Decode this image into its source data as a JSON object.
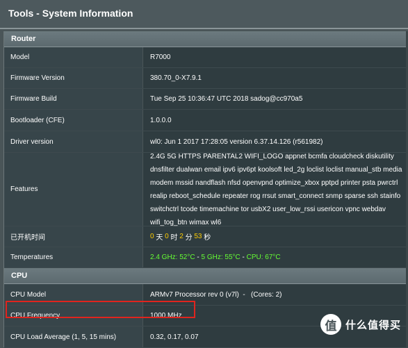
{
  "header": {
    "title": "Tools - System Information"
  },
  "router": {
    "section_label": "Router",
    "model_label": "Model",
    "model_value": "R7000",
    "firmware_version_label": "Firmware Version",
    "firmware_version_value": "380.70_0-X7.9.1",
    "firmware_build_label": "Firmware Build",
    "firmware_build_value": "Tue Sep 25 10:36:47 UTC 2018 sadog@cc970a5",
    "bootloader_label": "Bootloader (CFE)",
    "bootloader_value": "1.0.0.0",
    "driver_label": "Driver version",
    "driver_value": "wl0: Jun 1 2017 17:28:05 version 6.37.14.126 (r561982)",
    "features_label": "Features",
    "features_value": "2.4G 5G HTTPS PARENTAL2 WIFI_LOGO appnet bcmfa cloudcheck diskutility dnsfilter dualwan email ipv6 ipv6pt koolsoft led_2g loclist loclist manual_stb media modem mssid nandflash nfsd openvpnd optimize_xbox pptpd printer psta pwrctrl realip reboot_schedule repeater rog rrsut smart_connect snmp sparse ssh stainfo switchctrl tcode timemachine tor usbX2 user_low_rssi usericon vpnc webdav wifi_tog_btn wimax wl6",
    "uptime_label": "已开机时间",
    "uptime": {
      "days": "0",
      "days_unit": "天",
      "hours": "0",
      "hours_unit": "时",
      "minutes": "2",
      "minutes_unit": "分",
      "seconds": "53",
      "seconds_unit": "秒"
    },
    "temperatures_label": "Temperatures",
    "temperatures": {
      "ghz24": "2.4 GHz: 52°C",
      "sep1": " - ",
      "ghz5": "5 GHz: 55°C",
      "sep2": " - ",
      "cpu": "CPU: 67°C"
    }
  },
  "cpu": {
    "section_label": "CPU",
    "model_label": "CPU Model",
    "model_value": "ARMv7 Processor rev 0 (v7l)  -   (Cores: 2)",
    "frequency_label": "CPU Frequency",
    "frequency_value": "1000 MHz",
    "load_label": "CPU Load Average (1, 5, 15 mins)",
    "load_value": "0.32, 0.17, 0.07"
  },
  "watermark": {
    "icon_glyph": "值",
    "text": "什么值得买"
  },
  "colors": {
    "highlight_box": "#e0241e",
    "uptime_numbers": "#ffcc00",
    "temps": "#66ff33"
  }
}
